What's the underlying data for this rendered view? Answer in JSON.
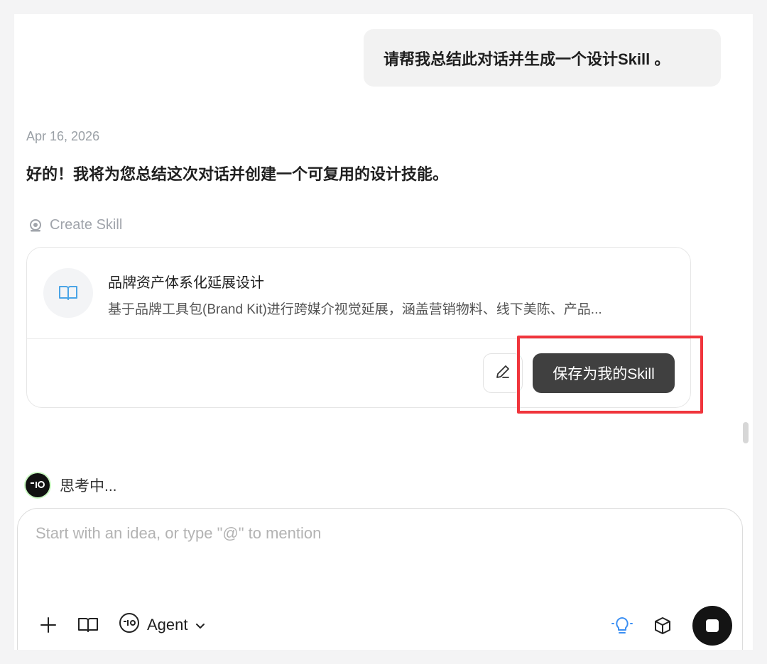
{
  "conversation": {
    "user_message": "请帮我总结此对话并生成一个设计Skill 。",
    "date": "Apr 16, 2026",
    "assistant_reply": "好的！我将为您总结这次对话并创建一个可复用的设计技能。",
    "tool_label": "Create Skill"
  },
  "skill_card": {
    "icon": "book-icon",
    "title": "品牌资产体系化延展设计",
    "description": "基于品牌工具包(Brand Kit)进行跨媒介视觉延展，涵盖营销物料、线下美陈、产品...",
    "edit_icon": "pencil-icon",
    "save_label": "保存为我的Skill"
  },
  "status": {
    "thinking_label": "思考中..."
  },
  "composer": {
    "placeholder": "Start with an idea, or type \"@\" to mention",
    "agent_label": "Agent",
    "tools_left": [
      "plus-icon",
      "book-icon",
      "agent-face-icon",
      "chevron-down-icon"
    ],
    "tools_right": [
      "lightbulb-icon",
      "cube-icon",
      "stop-icon"
    ]
  },
  "colors": {
    "highlight": "#f0353c",
    "save_button": "#404040",
    "lightbulb": "#3b8ff3"
  }
}
